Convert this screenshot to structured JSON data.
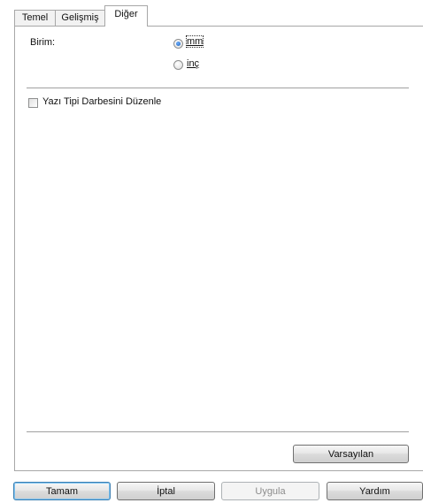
{
  "tabs": [
    {
      "label": "Temel",
      "active": false
    },
    {
      "label": "Gelişmiş",
      "active": false
    },
    {
      "label": "Diğer",
      "active": true
    }
  ],
  "units": {
    "label": "Birim:",
    "options": [
      {
        "label": "mm",
        "checked": true
      },
      {
        "label": "inç",
        "checked": false
      }
    ]
  },
  "font_stroke": {
    "label": "Yazı Tipi Darbesini Düzenle",
    "checked": false
  },
  "panel_buttons": {
    "defaults": "Varsayılan"
  },
  "dialog_buttons": {
    "ok": "Tamam",
    "cancel": "İptal",
    "apply": "Uygula",
    "help": "Yardım"
  },
  "colors": {
    "accent": "#1a5fb4",
    "border": "#a7a7a7"
  }
}
